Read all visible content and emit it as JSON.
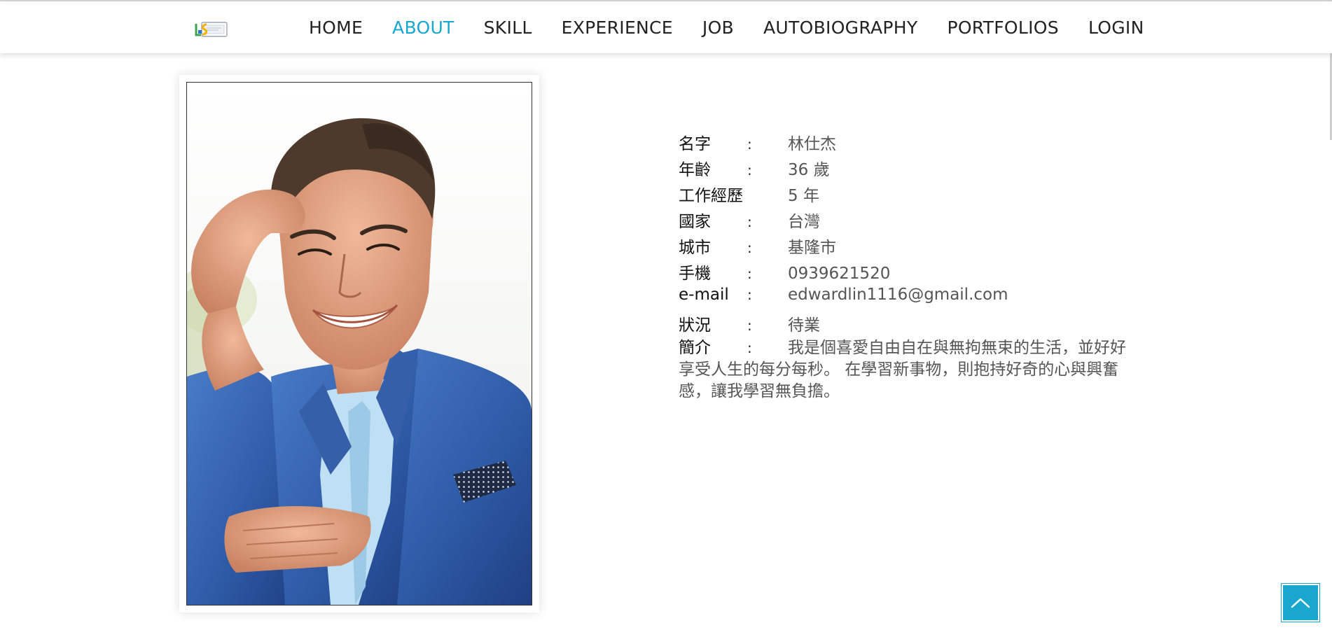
{
  "nav": {
    "items": [
      {
        "label": "HOME",
        "active": false
      },
      {
        "label": "ABOUT",
        "active": true
      },
      {
        "label": "SKILL",
        "active": false
      },
      {
        "label": "EXPERIENCE",
        "active": false
      },
      {
        "label": "JOB",
        "active": false
      },
      {
        "label": "AUTOBIOGRAPHY",
        "active": false
      },
      {
        "label": "PORTFOLIOS",
        "active": false
      },
      {
        "label": "LOGIN",
        "active": false
      }
    ],
    "active_color": "#1aa7cf"
  },
  "logo": {
    "icon": "site-logo-icon"
  },
  "profile": {
    "photo_icon": "profile-photo",
    "rows": [
      {
        "label": "名字",
        "colon": ":",
        "value": "林仕杰"
      },
      {
        "label": "年齡",
        "colon": ":",
        "value": "36 歲"
      },
      {
        "label": "工作經歷",
        "colon": "",
        "value": "5 年"
      },
      {
        "label": "國家",
        "colon": ":",
        "value": "台灣"
      },
      {
        "label": "城市",
        "colon": ":",
        "value": "基隆市"
      },
      {
        "label": "手機",
        "colon": ":",
        "value": "0939621520"
      },
      {
        "label": "e-mail",
        "colon": ":",
        "value": "edwardlin1116@gmail.com"
      },
      {
        "label": "狀況",
        "colon": ":",
        "value": "待業"
      }
    ],
    "intro": {
      "label": "簡介",
      "colon": ":",
      "text": "我是個喜愛自由自在與無拘無束的生活，並好好享受人生的每分每秒。 在學習新事物，則抱持好奇的心與興奮感，讓我學習無負擔。"
    }
  },
  "back_to_top": {
    "icon": "chevron-up-icon",
    "color": "#1aa7cf"
  }
}
